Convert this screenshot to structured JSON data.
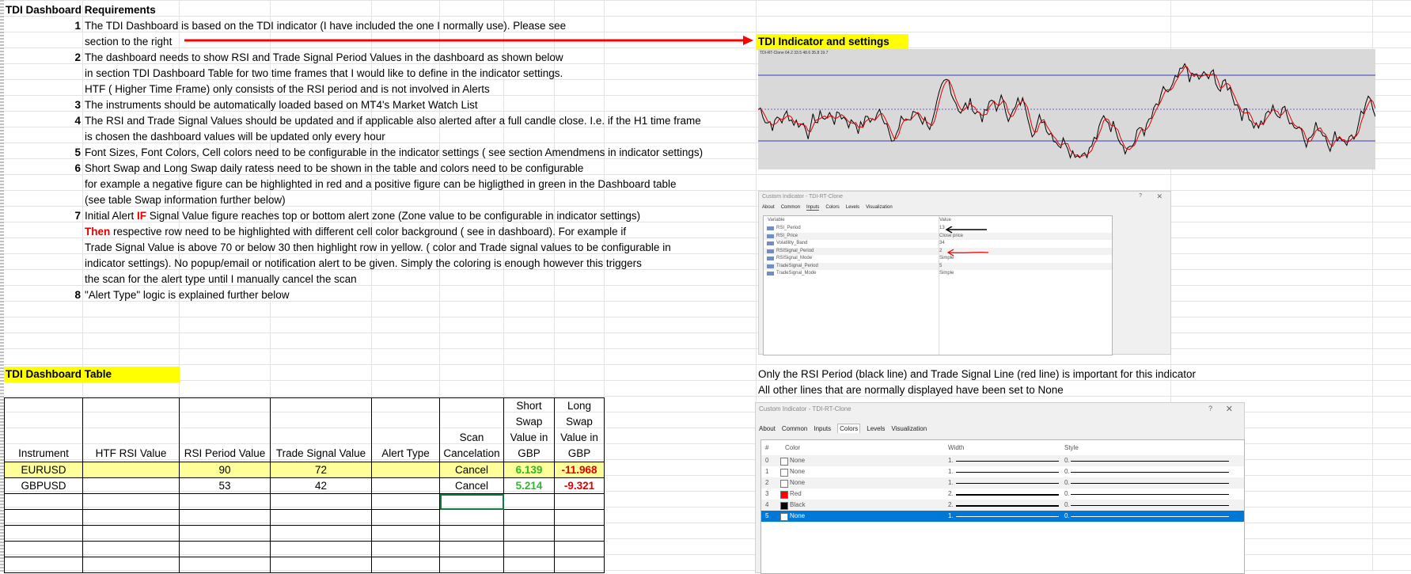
{
  "requirements": {
    "title": "TDI Dashboard Requirements",
    "items": [
      {
        "n": "1",
        "lines": [
          "The TDI Dashboard is based on the TDI indicator (I have included the one I normally use). Please see",
          "section to the right"
        ]
      },
      {
        "n": "2",
        "lines": [
          "The dashboard needs to show RSI and Trade Signal Period Values in the dashboard as shown below",
          "in section TDI Dashboard Table for two time frames that I would like to define in the indicator settings.",
          "HTF ( Higher Time Frame) only consists of the RSI period and is not involved in Alerts"
        ]
      },
      {
        "n": "3",
        "lines": [
          "The instruments should be automatically loaded based on MT4's Market Watch List"
        ]
      },
      {
        "n": "4",
        "lines": [
          "The RSI and Trade Signal Values should be updated and if applicable also alerted after a full candle close. I.e. if the H1 time frame",
          "is chosen the dashboard values will be updated only every hour"
        ]
      },
      {
        "n": "5",
        "lines": [
          "Font Sizes, Font Colors, Cell colors need to be configurable in the indicator settings ( see section Amendmens in indicator settings)"
        ]
      },
      {
        "n": "6",
        "lines": [
          "Short Swap and Long Swap daily ratess need to be shown in the table and colors need to be configurable",
          "for example a negative figure can be highlighted in red and a positive figure can be higligthed in green in the Dashboard table",
          "(see table Swap information further below)"
        ]
      },
      {
        "n": "7",
        "line1_a": "Initial Alert ",
        "line1_if": "IF",
        "line1_b": " Signal Value figure reaches top or bottom alert zone (Zone value to be configurable in indicator settings)",
        "line2_then": "Then",
        "line2_b": "  respective row need to be highlighted with different cell color background ( see in dashboard). For example if",
        "lines": [
          "Trade Signal Value is above 70 or below 30 then highlight row in yellow. ( color and Trade signal values to be configurable in",
          " indicator settings). No popup/email or notification alert to be given. Simply the coloring is enough however this triggers",
          "the scan for the alert type until I manually cancel the scan"
        ]
      },
      {
        "n": "8",
        "lines": [
          "\"Alert Type\" logic is explained further below"
        ]
      }
    ]
  },
  "indicator": {
    "heading": "TDI Indicator and settings",
    "chart_label": "TDI-RT-Clone 64.2 33.5 48.6 35.8 19.7",
    "note1": "Only the RSI Period (black line) and Trade Signal Line (red line) is important for this indicator",
    "note2": "All other lines that are normally displayed have been set to None"
  },
  "inputs_dialog": {
    "title": "Custom Indicator - TDI-RT-Clone",
    "tabs": [
      "About",
      "Common",
      "Inputs",
      "Colors",
      "Levels",
      "Visualization"
    ],
    "col_variable": "Variable",
    "col_value": "Value",
    "rows": [
      {
        "var": "RSI_Period",
        "val": "13"
      },
      {
        "var": "RSI_Price",
        "val": "Close price"
      },
      {
        "var": "Volatility_Band",
        "val": "34"
      },
      {
        "var": "RSISignal_Period",
        "val": "2"
      },
      {
        "var": "RSISignal_Mode",
        "val": "Simple"
      },
      {
        "var": "TradeSignal_Period",
        "val": "5"
      },
      {
        "var": "TradeSignal_Mode",
        "val": "Simple"
      }
    ]
  },
  "colors_dialog": {
    "title": "Custom Indicator - TDI-RT-Clone",
    "tabs": [
      "About",
      "Common",
      "Inputs",
      "Colors",
      "Levels",
      "Visualization"
    ],
    "col_n": "#",
    "col_color": "Color",
    "col_width": "Width",
    "col_style": "Style",
    "rows": [
      {
        "n": "0",
        "color": "None",
        "swatch": "#ffffff",
        "width": "1.",
        "style": "0."
      },
      {
        "n": "1",
        "color": "None",
        "swatch": "#ffffff",
        "width": "1.",
        "style": "0."
      },
      {
        "n": "2",
        "color": "None",
        "swatch": "#ffffff",
        "width": "1.",
        "style": "0."
      },
      {
        "n": "3",
        "color": "Red",
        "swatch": "#ff0000",
        "width": "2.",
        "style": "0."
      },
      {
        "n": "4",
        "color": "Black",
        "swatch": "#000000",
        "width": "2.",
        "style": "0."
      },
      {
        "n": "5",
        "color": "None",
        "swatch": "#ffffff",
        "width": "1.",
        "style": "0."
      }
    ],
    "help": "?",
    "close": "✕"
  },
  "dashboard": {
    "heading": "TDI Dashboard Table",
    "headers": [
      "Instrument",
      "HTF RSI Value",
      "RSI Period Value",
      "Trade Signal Value",
      "Alert Type",
      "Scan Cancelation",
      "Short Swap Value in GBP",
      "Long Swap Value in GBP"
    ],
    "rows": [
      {
        "instrument": "EURUSD",
        "htf": "",
        "rsi": "90",
        "signal": "72",
        "alert": "",
        "scan": "Cancel",
        "short": "6.139",
        "long": "-11.968",
        "highlight": true
      },
      {
        "instrument": "GBPUSD",
        "htf": "",
        "rsi": "53",
        "signal": "42",
        "alert": "",
        "scan": "Cancel",
        "short": "5.214",
        "long": "-9.321",
        "highlight": false
      }
    ]
  }
}
